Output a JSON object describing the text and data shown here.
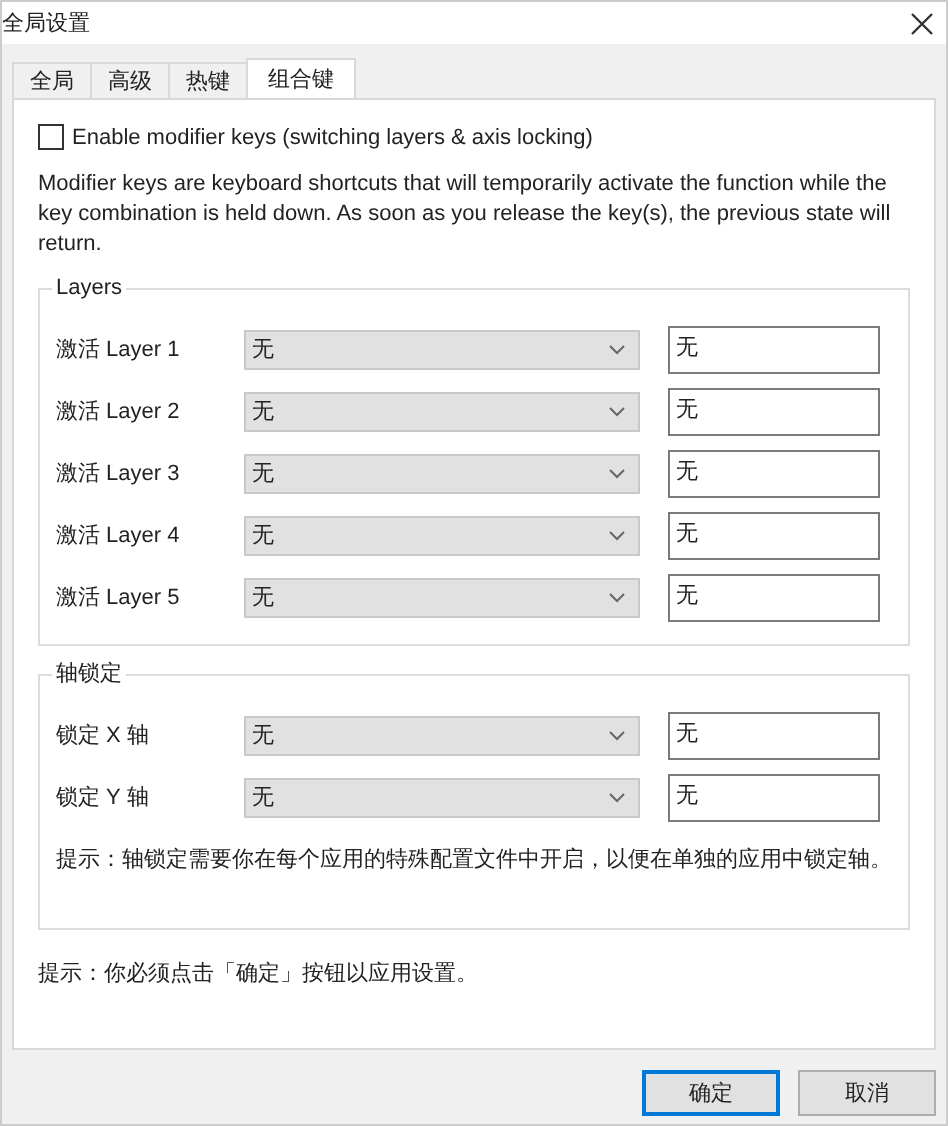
{
  "window": {
    "title": "全局设置"
  },
  "tabs": [
    {
      "label": "全局",
      "selected": false
    },
    {
      "label": "高级",
      "selected": false
    },
    {
      "label": "热键",
      "selected": false
    },
    {
      "label": "组合键",
      "selected": true
    }
  ],
  "enable_modifier_keys": {
    "label": "Enable modifier keys (switching layers & axis locking)",
    "checked": false
  },
  "description": "Modifier keys are keyboard shortcuts that will temporarily activate the function while the key combination is held down. As soon as you release the key(s), the previous state will return.",
  "groups": [
    {
      "title": "Layers",
      "rows": [
        {
          "label": "激活 Layer 1",
          "dropdown": "无",
          "field": "无"
        },
        {
          "label": "激活 Layer 2",
          "dropdown": "无",
          "field": "无"
        },
        {
          "label": "激活 Layer 3",
          "dropdown": "无",
          "field": "无"
        },
        {
          "label": "激活 Layer 4",
          "dropdown": "无",
          "field": "无"
        },
        {
          "label": "激活 Layer 5",
          "dropdown": "无",
          "field": "无"
        }
      ]
    },
    {
      "title": "轴锁定",
      "rows": [
        {
          "label": "锁定 X 轴",
          "dropdown": "无",
          "field": "无"
        },
        {
          "label": "锁定 Y 轴",
          "dropdown": "无",
          "field": "无"
        }
      ],
      "hint": "提示：轴锁定需要你在每个应用的特殊配置文件中开启，以便在单独的应用中锁定轴。"
    }
  ],
  "hint": "提示：你必须点击「确定」按钮以应用设置。",
  "buttons": [
    {
      "label": "确定",
      "default": true
    },
    {
      "label": "取消",
      "default": false
    }
  ]
}
